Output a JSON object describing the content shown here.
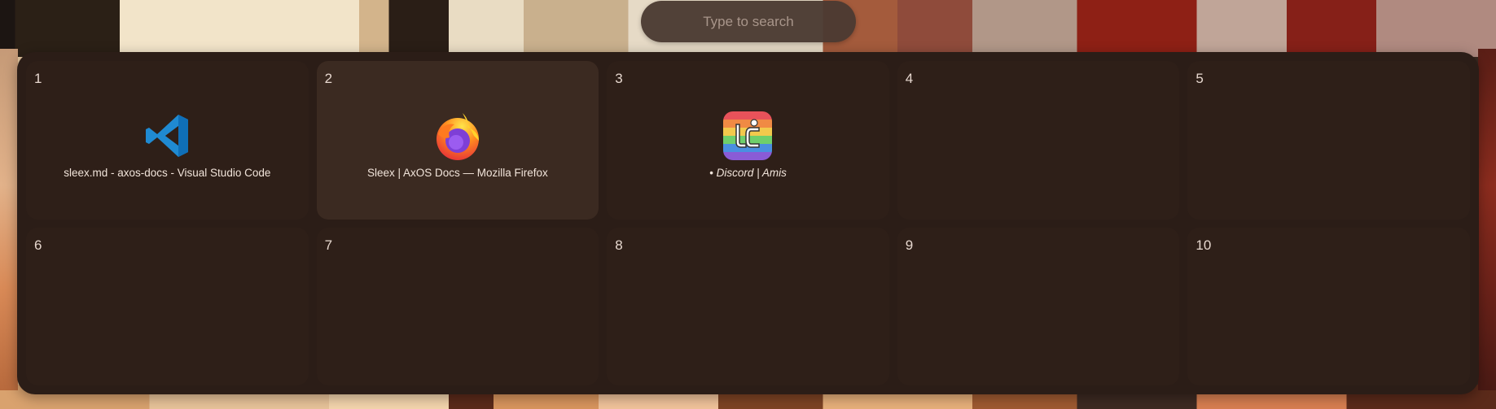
{
  "search": {
    "placeholder": "Type to search"
  },
  "workspaces": [
    {
      "number": "1",
      "window": {
        "title": "sleex.md - axos-docs - Visual Studio Code",
        "icon": "vscode-icon"
      }
    },
    {
      "number": "2",
      "window": {
        "title": "Sleex | AxOS Docs — Mozilla Firefox",
        "icon": "firefox-icon"
      }
    },
    {
      "number": "3",
      "window": {
        "title": "• Discord | Amis",
        "icon": "discord-app-icon"
      }
    },
    {
      "number": "4"
    },
    {
      "number": "5"
    },
    {
      "number": "6"
    },
    {
      "number": "7"
    },
    {
      "number": "8"
    },
    {
      "number": "9"
    },
    {
      "number": "10"
    }
  ],
  "colors": {
    "panel": "#2b1d17",
    "workspace": "#2e1f18",
    "active_workspace": "#3b2a21",
    "search_bg": "#4b3a32",
    "text": "#f1e4da"
  }
}
